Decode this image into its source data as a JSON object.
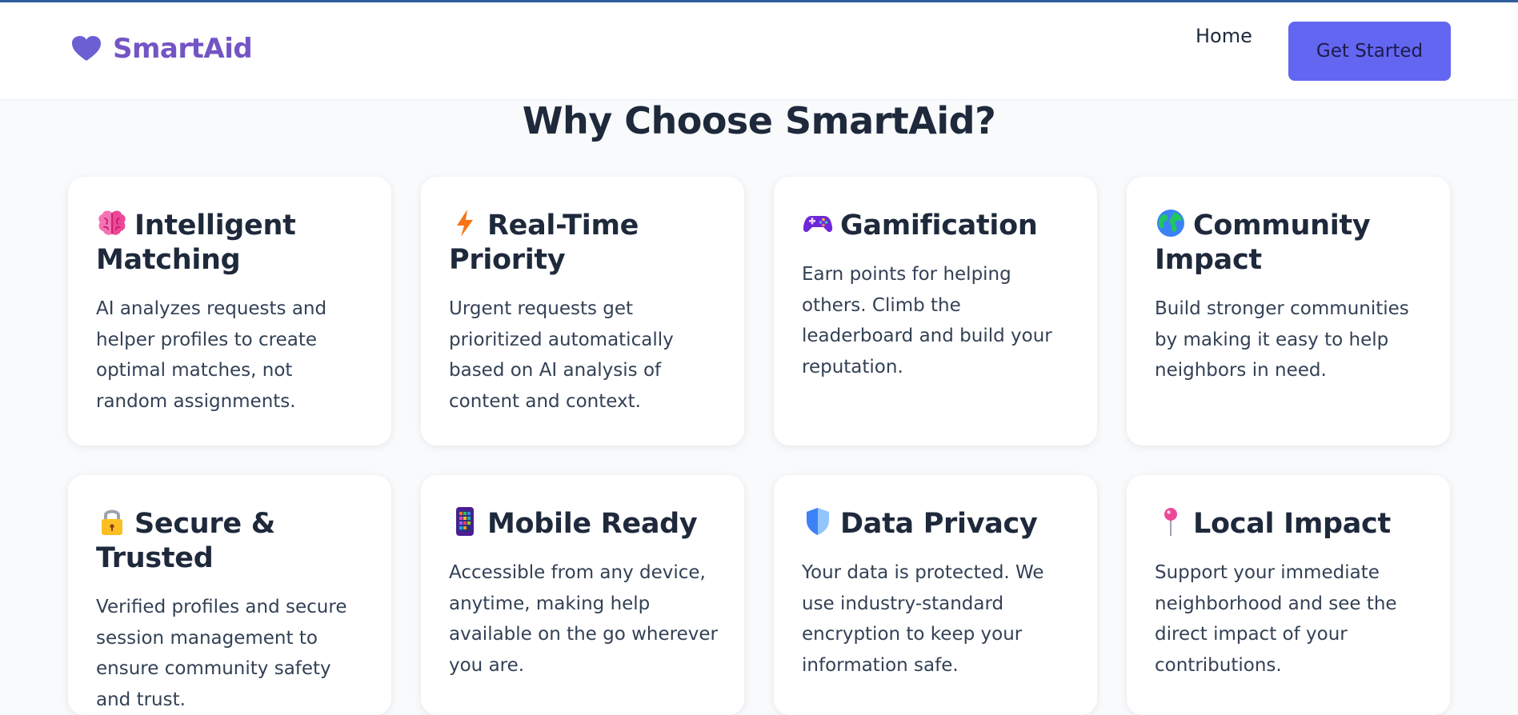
{
  "header": {
    "brand": "SmartAid",
    "nav_home": "Home",
    "cta_label": "Get Started"
  },
  "section": {
    "title": "Why Choose SmartAid?"
  },
  "features": [
    {
      "icon": "brain-icon",
      "title": "Intelligent Matching",
      "description": "AI analyzes requests and helper profiles to create optimal matches, not random assignments."
    },
    {
      "icon": "lightning-icon",
      "title": "Real-Time Priority",
      "description": "Urgent requests get prioritized automatically based on AI analysis of content and context."
    },
    {
      "icon": "gamepad-icon",
      "title": "Gamification",
      "description": "Earn points for helping others. Climb the leaderboard and build your reputation."
    },
    {
      "icon": "globe-icon",
      "title": "Community Impact",
      "description": "Build stronger communities by making it easy to help neighbors in need."
    },
    {
      "icon": "lock-icon",
      "title": "Secure & Trusted",
      "description": "Verified profiles and secure session management to ensure community safety and trust."
    },
    {
      "icon": "phone-icon",
      "title": "Mobile Ready",
      "description": "Accessible from any device, anytime, making help available on the go wherever you are."
    },
    {
      "icon": "shield-icon",
      "title": "Data Privacy",
      "description": "Your data is protected. We use industry-standard encryption to keep your information safe."
    },
    {
      "icon": "pin-icon",
      "title": "Local Impact",
      "description": "Support your immediate neighborhood and see the direct impact of your contributions."
    }
  ],
  "colors": {
    "brand": "#7355c4",
    "accent": "#6366f1",
    "top_line": "#2f5d9b",
    "background": "#f8fafc"
  }
}
